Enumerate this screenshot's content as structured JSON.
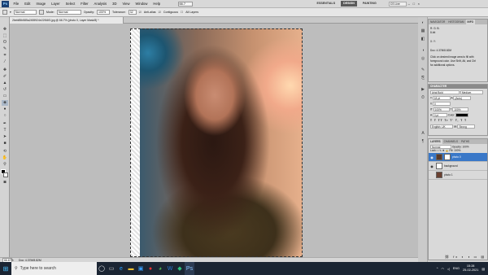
{
  "app": {
    "logo": "Ps"
  },
  "menu": [
    "File",
    "Edit",
    "Image",
    "Layer",
    "Select",
    "Filter",
    "Analysis",
    "3D",
    "View",
    "Window",
    "Help"
  ],
  "zoom_menu": "66.7",
  "workspace": {
    "essentials": "ESSENTIALS",
    "design": "DESIGN",
    "painting": "PAINTING",
    "cs_live": "CS Live"
  },
  "options": {
    "feather_label": "Feather: 0 px",
    "mode_label": "Mode:",
    "mode_value": "Normal",
    "opacity_label": "Opacity:",
    "opacity_value": "100%",
    "tolerance_label": "Tolerance:",
    "tolerance_value": "32",
    "antialias": "Anti-alias",
    "contiguous": "Contiguous",
    "all_layers": "All Layers"
  },
  "document": {
    "tab_title": "2beb85b585a2455924e22f16f3.jpg @ 66.7% (photo 0, Layer Mask/8) *"
  },
  "status": {
    "zoom": "66.67%",
    "doc": "Doc: 4.37M/8.82M"
  },
  "info_panel": {
    "tabs": [
      "NAVIGATOR",
      "HISTOGRAM",
      "INFO"
    ],
    "rows": [
      "R:  G:  B:",
      "8-bit",
      "X:  Y:",
      "Doc: 4.37M/8.82M",
      "Click on desired image area to fill with",
      "foreground color. Use Shift, Alt, and Ctrl",
      "for additional options."
    ]
  },
  "char_panel": {
    "title": "CHARACTER",
    "font": "Arial Bold",
    "style": "Medium",
    "size": "18 pt",
    "leading": "(Auto)",
    "tracking": "0",
    "scale_v": "100%",
    "scale_h": "100%",
    "baseline": "0 pt",
    "color_label": "Color:",
    "lang": "English: UK",
    "aa": "Strong"
  },
  "layers_panel": {
    "tabs": [
      "LAYERS",
      "CHANNELS",
      "PATHS"
    ],
    "blend": "Normal",
    "opacity": "Opacity: 100%",
    "fill": "Fill: 100%",
    "lock": "Lock:",
    "layers": [
      {
        "name": "photo 0",
        "selected": true
      },
      {
        "name": "background",
        "selected": false
      },
      {
        "name": "photo 1",
        "selected": false
      }
    ]
  },
  "taskbar": {
    "search_placeholder": "Type here to search",
    "lang": "ENG",
    "time": "15:28",
    "date": "25-02-2021"
  }
}
